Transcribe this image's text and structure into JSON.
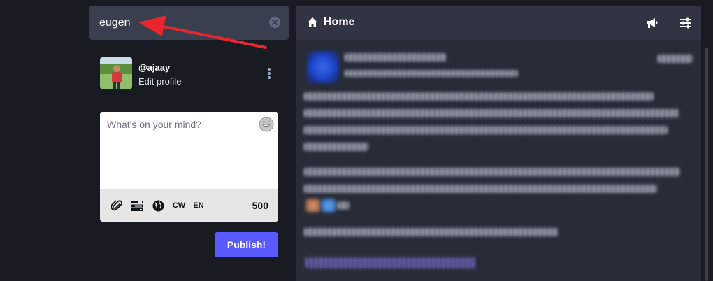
{
  "search": {
    "value": "eugen"
  },
  "account": {
    "handle": "@ajaay",
    "edit_label": "Edit profile"
  },
  "compose": {
    "placeholder": "What's on your mind?",
    "tools": {
      "cw_label": "CW",
      "lang_label": "EN"
    },
    "char_count": "500",
    "publish_label": "Publish!"
  },
  "home": {
    "title": "Home"
  },
  "colors": {
    "publish": "#595aff",
    "annotation_arrow": "#e8262b"
  },
  "icons": {
    "search_clear": "times-circle-icon",
    "account_menu": "ellipsis-vertical-icon",
    "emoji": "grinning-emoji-icon",
    "attach": "paperclip-icon",
    "poll": "tasks-icon",
    "visibility": "globe-icon",
    "home": "home-icon",
    "announcements": "bullhorn-icon",
    "settings": "sliders-icon"
  }
}
